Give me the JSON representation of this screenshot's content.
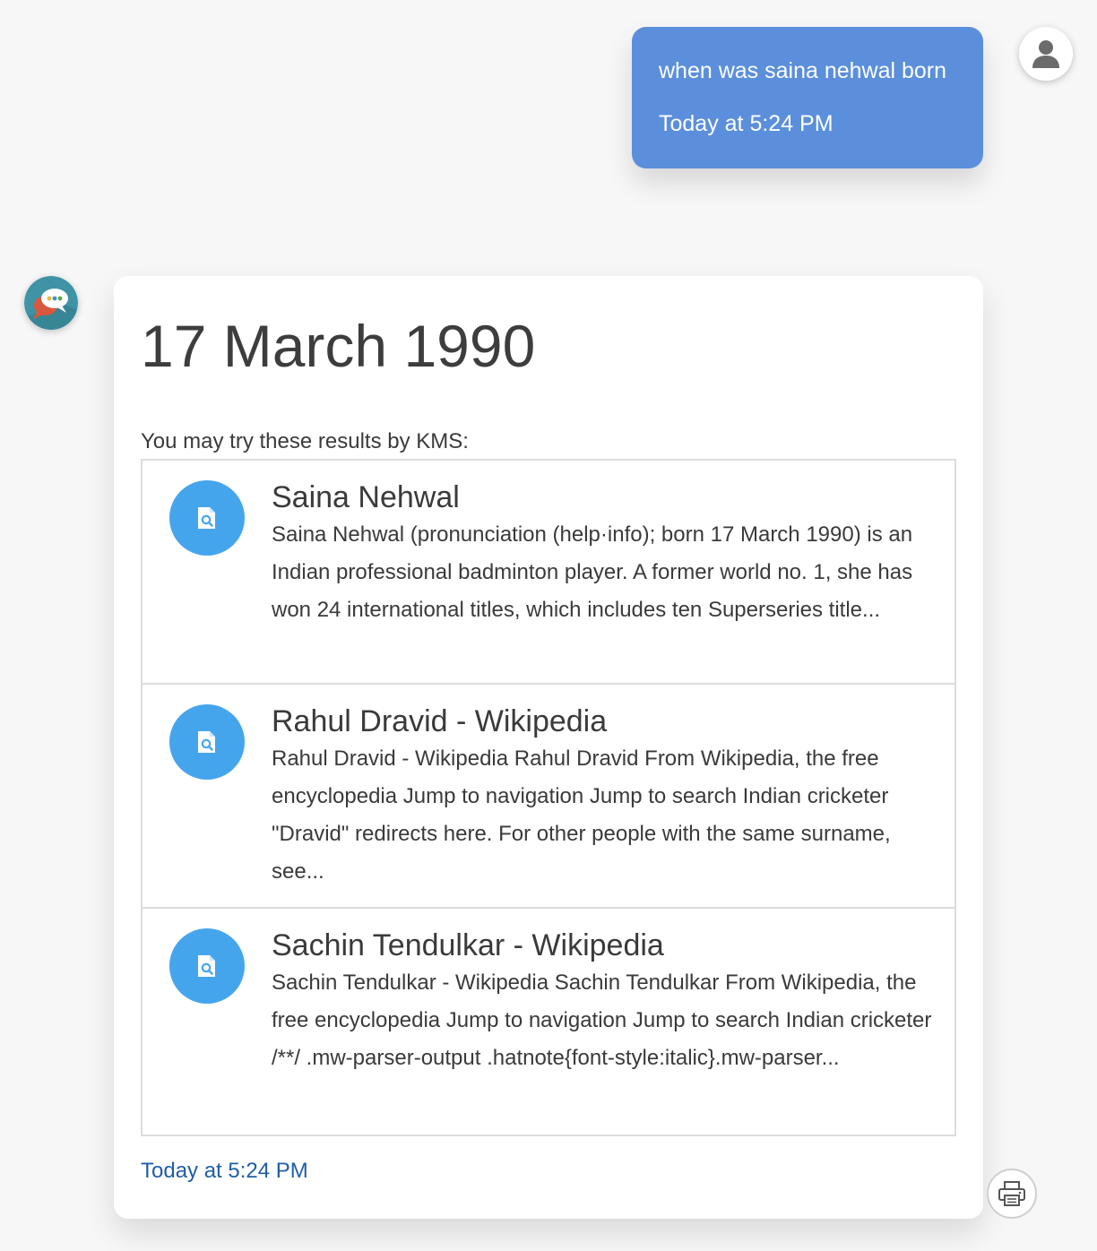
{
  "user_message": {
    "text": "when was saina nehwal born",
    "timestamp": "Today at 5:24 PM",
    "avatar_icon": "user-silhouette-icon",
    "bubble_color": "#5b8fdc"
  },
  "bot_message": {
    "avatar_icon": "chat-bubbles-logo-icon",
    "answer": "17 March 1990",
    "results_intro": "You may try these results by KMS:",
    "results": [
      {
        "icon": "document-search-icon",
        "title": "Saina Nehwal",
        "snippet": "Saina Nehwal (pronunciation (help·info); born 17 March 1990) is an Indian professional badminton player. A former world no. 1, she has won 24 international titles, which includes ten Superseries title..."
      },
      {
        "icon": "document-search-icon",
        "title": "Rahul Dravid - Wikipedia",
        "snippet": "Rahul Dravid - Wikipedia Rahul Dravid From Wikipedia, the free encyclopedia Jump to navigation Jump to search Indian cricketer \"Dravid\" redirects here. For other people with the same surname, see..."
      },
      {
        "icon": "document-search-icon",
        "title": "Sachin Tendulkar - Wikipedia",
        "snippet": "Sachin Tendulkar - Wikipedia Sachin Tendulkar From Wikipedia, the free encyclopedia Jump to navigation Jump to search Indian cricketer /**/ .mw-parser-output .hatnote{font-style:italic}.mw-parser..."
      }
    ],
    "timestamp": "Today at 5:24 PM",
    "timestamp_color": "#1f5ea8",
    "result_icon_color": "#45a5ec"
  },
  "print_button": {
    "icon": "printer-icon"
  }
}
